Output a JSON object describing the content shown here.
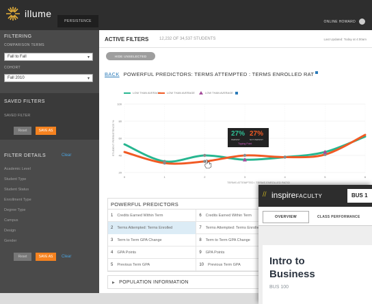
{
  "header": {
    "brand": "illume",
    "nav_item": "PERSISTENCE",
    "user": "ONLINE HOWARD"
  },
  "sidebar": {
    "filter_heading": "FILTERING",
    "comparison_label": "COMPARISON TERMS",
    "comparison_value": "Fall to Fall",
    "cohort_label": "COHORT",
    "cohort_value": "Fall 2010",
    "saved_heading": "SAVED FILTERS",
    "saved_placeholder": "SAVED FILTER",
    "reset": "Reset",
    "save": "SAVE AS",
    "details_heading": "FILTER DETAILS",
    "details_link": "Clear",
    "details_items": [
      "Academic Level",
      "Student Type",
      "Student Status",
      "Enrollment Type",
      "Degree Type",
      "Campus",
      "Design",
      "Gender"
    ],
    "reset2": "Reset",
    "save2": "SAVE AS",
    "clear2": "Clear"
  },
  "main": {
    "active_filters": "ACTIVE FILTERS",
    "count": "12,232 OF 34,537 STUDENTS",
    "updated": "Last Updated: Today at 4:00am",
    "chip": "HIDE UNSELECTED"
  },
  "chart_data": {
    "type": "line",
    "back_link": "BACK",
    "title": "POWERFUL PREDICTORS: TERMS ATTEMPTED : TERMS ENROLLED RAT",
    "legend": [
      "LOW THAN AVERAGE",
      "LOW THAN AVERAGE",
      "LOW THAN AVERAGE"
    ],
    "ylabel": "STUDENT PERSISTENCE %",
    "xlabel": "TERMS ATTEMPTED / TERMS ENROLLED RATIO",
    "yticks": [
      "100",
      "80",
      "60",
      "40",
      "20"
    ],
    "xticks": [
      "0",
      "1",
      "2",
      "3",
      "4",
      "5",
      "6"
    ],
    "x": [
      0,
      1,
      2,
      3,
      4,
      5,
      6
    ],
    "series": [
      {
        "values": [
          53,
          33,
          40,
          35,
          38,
          44,
          62
        ]
      },
      {
        "values": [
          44,
          31,
          33,
          40,
          38,
          41,
          64
        ]
      }
    ],
    "tooltip": {
      "value_a": "27%",
      "value_b": "27%",
      "label_a": "PERSIST",
      "label_b": "NOT PERSIST",
      "caption": "Tipping Point"
    },
    "colors": {
      "series_a": "#27b690",
      "series_b": "#f15a24",
      "marker": "#a44b9a",
      "point": "#8a8a8a"
    }
  },
  "predictors": {
    "heading": "POWERFUL PREDICTORS",
    "rows": [
      [
        {
          "n": "1",
          "t": "Credits Earned Within Term"
        },
        {
          "n": "6",
          "t": "Credits Earned Within Term"
        }
      ],
      [
        {
          "n": "2",
          "t": "Terms Attempted: Terms Enrolled"
        },
        {
          "n": "7",
          "t": "Terms Attempted: Terms Enrolled"
        }
      ],
      [
        {
          "n": "3",
          "t": "Term to Term GPA Change"
        },
        {
          "n": "8",
          "t": "Term to Term GPA Change"
        }
      ],
      [
        {
          "n": "4",
          "t": "GPA Points"
        },
        {
          "n": "9",
          "t": "GPA Points"
        }
      ],
      [
        {
          "n": "5",
          "t": "Previous Term GPA"
        },
        {
          "n": "10",
          "t": "Previous Term GPA"
        }
      ]
    ],
    "population": "POPULATION INFORMATION"
  },
  "overlay": {
    "brand": "inspire",
    "brand_sub": "FACULTY",
    "course_tab": "BUS 1",
    "tab_overview": "OVERVIEW",
    "tab_class": "CLASS PERFORMANCE",
    "title": "Intro to Business",
    "code": "BUS 100"
  }
}
